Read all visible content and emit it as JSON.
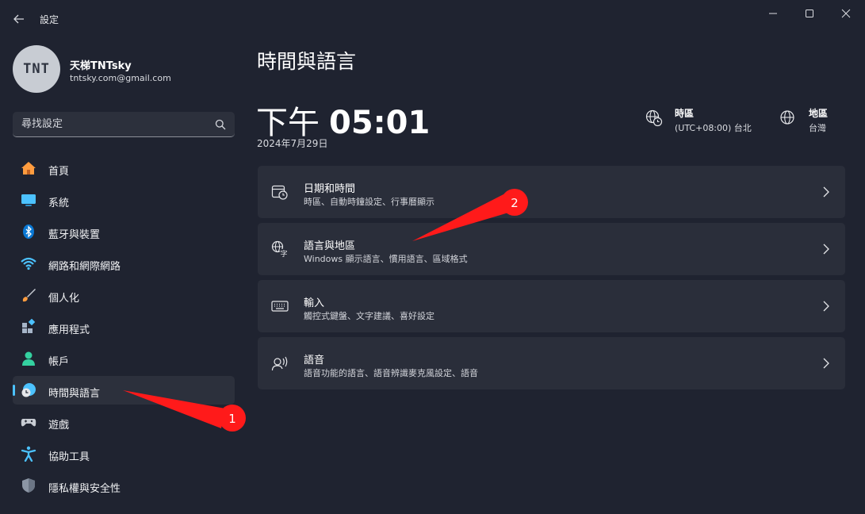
{
  "window": {
    "title": "設定",
    "controls": {
      "minimize": "minimize-icon",
      "maximize": "maximize-icon",
      "close": "close-icon"
    }
  },
  "user": {
    "avatar_text": "TNT",
    "name": "天梯TNTsky",
    "email": "tntsky.com@gmail.com"
  },
  "search": {
    "placeholder": "尋找設定"
  },
  "sidebar": {
    "items": [
      {
        "label": "首頁",
        "icon": "home-icon",
        "active": false
      },
      {
        "label": "系統",
        "icon": "system-icon",
        "active": false
      },
      {
        "label": "藍牙與裝置",
        "icon": "bluetooth-icon",
        "active": false
      },
      {
        "label": "網路和網際網路",
        "icon": "wifi-icon",
        "active": false
      },
      {
        "label": "個人化",
        "icon": "brush-icon",
        "active": false
      },
      {
        "label": "應用程式",
        "icon": "apps-icon",
        "active": false
      },
      {
        "label": "帳戶",
        "icon": "account-icon",
        "active": false
      },
      {
        "label": "時間與語言",
        "icon": "time-language-icon",
        "active": true
      },
      {
        "label": "遊戲",
        "icon": "gamepad-icon",
        "active": false
      },
      {
        "label": "協助工具",
        "icon": "accessibility-icon",
        "active": false
      },
      {
        "label": "隱私權與安全性",
        "icon": "shield-icon",
        "active": false
      }
    ]
  },
  "main": {
    "title": "時間與語言",
    "time_ampm": "下午",
    "time_hhmm": "05:01",
    "date": "2024年7月29日",
    "timezone": {
      "label": "時區",
      "value": "(UTC+08:00) 台北"
    },
    "region": {
      "label": "地區",
      "value": "台灣"
    },
    "cards": [
      {
        "title": "日期和時間",
        "subtitle": "時區、自動時鐘設定、行事曆顯示",
        "icon": "calendar-clock-icon"
      },
      {
        "title": "語言與地區",
        "subtitle": "Windows 顯示語言、慣用語言、區域格式",
        "icon": "language-icon"
      },
      {
        "title": "輸入",
        "subtitle": "觸控式鍵盤、文字建議、喜好設定",
        "icon": "keyboard-icon"
      },
      {
        "title": "語音",
        "subtitle": "語音功能的語言、語音辨識麥克風設定、語音",
        "icon": "speech-icon"
      }
    ]
  },
  "annotations": [
    {
      "number": "1",
      "color": "#ff1a1a"
    },
    {
      "number": "2",
      "color": "#ff1a1a"
    }
  ],
  "colors": {
    "accent": "#4cc2ff",
    "background": "#1f2330",
    "card": "#2a2e3a",
    "annotation": "#ff1a1a"
  }
}
